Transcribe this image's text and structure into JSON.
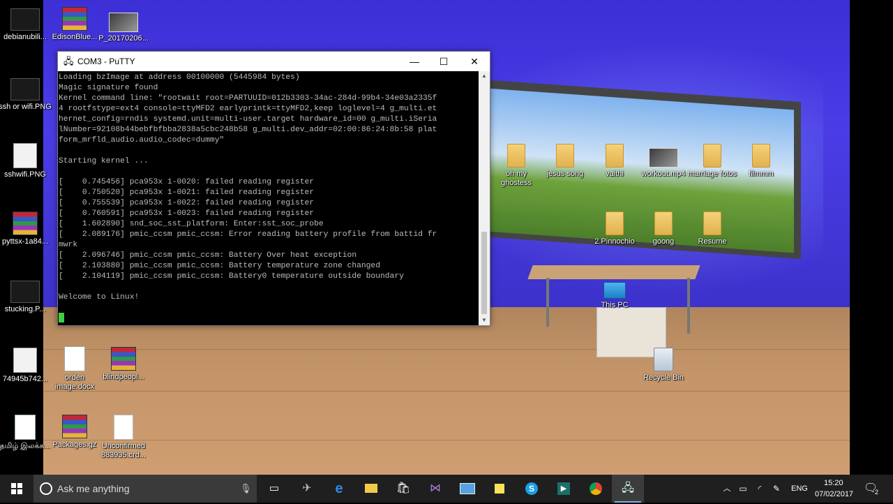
{
  "desktop": {
    "icons": [
      {
        "label": "debianubili...",
        "type": "thumb-dark"
      },
      {
        "label": "EdisonBlue...",
        "type": "rar"
      },
      {
        "label": "P_20170206...",
        "type": "photo"
      },
      {
        "label": "ssh or wifi.PNG",
        "type": "thumb-dark"
      },
      {
        "label": "sshwifi.PNG",
        "type": "thumb-light"
      },
      {
        "label": "pyttsx-1a84...",
        "type": "rar"
      },
      {
        "label": "stucking.P...",
        "type": "thumb-dark"
      },
      {
        "label": "74945b742...",
        "type": "thumb-light"
      },
      {
        "label": "orden image.docx",
        "type": "doc"
      },
      {
        "label": "blindpeopl...",
        "type": "rar"
      },
      {
        "label": "தமிழ் இலக்க...",
        "type": "doc"
      },
      {
        "label": "Packages.gz",
        "type": "rar"
      },
      {
        "label": "Unconfirmed 883935.crd...",
        "type": "blank"
      },
      {
        "label": "oh my ghostess",
        "type": "folder"
      },
      {
        "label": "jesus song",
        "type": "folder"
      },
      {
        "label": "vaithi",
        "type": "folder"
      },
      {
        "label": "workout.mp4",
        "type": "photo"
      },
      {
        "label": "marriage fotos",
        "type": "folder"
      },
      {
        "label": "filmmm",
        "type": "folder"
      },
      {
        "label": "2.Pinnochio",
        "type": "folder"
      },
      {
        "label": "goong",
        "type": "folder"
      },
      {
        "label": "Resume",
        "type": "folder"
      },
      {
        "label": "This PC",
        "type": "pc"
      },
      {
        "label": "Recycle Bin",
        "type": "bin"
      }
    ]
  },
  "putty": {
    "title": "COM3 - PuTTY",
    "minimize": "—",
    "maximize": "☐",
    "close": "✕",
    "lines": [
      "Loading bzImage at address 00100000 (5445984 bytes)",
      "Magic signature found",
      "Kernel command line: \"rootwait root=PARTUUID=012b3303-34ac-284d-99b4-34e03a2335f",
      "4 rootfstype=ext4 console=ttyMFD2 earlyprintk=ttyMFD2,keep loglevel=4 g_multi.et",
      "hernet_config=rndis systemd.unit=multi-user.target hardware_id=00 g_multi.iSeria",
      "lNumber=92108b44bebfbfbba2838a5cbc248b58 g_multi.dev_addr=02:00:86:24:8b:58 plat",
      "form_mrfld_audio.audio_codec=dummy\"",
      "",
      "Starting kernel ...",
      "",
      "[    0.745456] pca953x 1-0020: failed reading register",
      "[    0.750520] pca953x 1-0021: failed reading register",
      "[    0.755539] pca953x 1-0022: failed reading register",
      "[    0.760591] pca953x 1-0023: failed reading register",
      "[    1.602890] snd_soc_sst_platform: Enter:sst_soc_probe",
      "[    2.089176] pmic_ccsm pmic_ccsm: Error reading battery profile from battid fr",
      "mwrk",
      "[    2.096746] pmic_ccsm pmic_ccsm: Battery Over heat exception",
      "[    2.103880] pmic_ccsm pmic_ccsm: Battery temperature zone changed",
      "[    2.104119] pmic_ccsm pmic_ccsm: Battery0 temperature outside boundary",
      "",
      "Welcome to Linux!"
    ]
  },
  "taskbar": {
    "search_placeholder": "Ask me anything",
    "apps": [
      "task-view",
      "network-tool",
      "edge",
      "file-explorer",
      "store",
      "visual-studio",
      "remote-desktop",
      "sticky-notes",
      "skype",
      "arduino",
      "chrome",
      "putty"
    ],
    "language": "ENG",
    "time": "15:20",
    "date": "07/02/2017",
    "notification_count": "2"
  }
}
